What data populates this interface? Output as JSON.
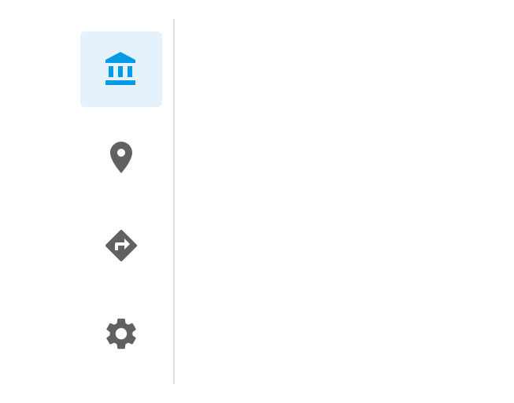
{
  "nav_rail": {
    "selected_index": 0,
    "items": [
      {
        "id": "institution",
        "icon": "account-balance-icon"
      },
      {
        "id": "place",
        "icon": "location-pin-icon"
      },
      {
        "id": "directions",
        "icon": "directions-icon"
      },
      {
        "id": "settings",
        "icon": "settings-gear-icon"
      }
    ]
  },
  "colors": {
    "selected_icon": "#039be5",
    "selected_background": "#e3f2fd",
    "unselected_icon": "#616161",
    "divider": "#dcdcdc",
    "background": "#ffffff"
  }
}
